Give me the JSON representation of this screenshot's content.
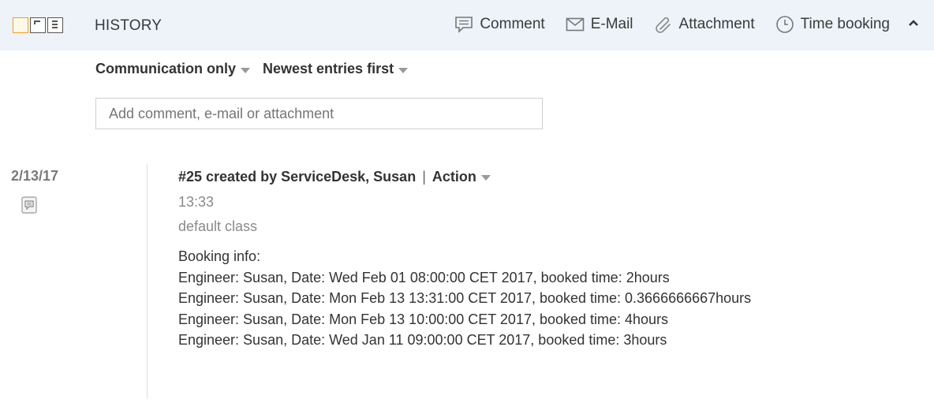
{
  "header": {
    "title": "HISTORY",
    "actions": {
      "comment": "Comment",
      "email": "E-Mail",
      "attachment": "Attachment",
      "time_booking": "Time booking"
    }
  },
  "filters": {
    "type": "Communication only",
    "order": "Newest entries first"
  },
  "add_box": {
    "placeholder": "Add comment, e-mail or attachment"
  },
  "entry": {
    "date": "2/13/17",
    "title": "#25 created by ServiceDesk, Susan",
    "separator": "|",
    "action": "Action",
    "time": "13:33",
    "class": "default class",
    "body_heading": "Booking info:",
    "lines": [
      "Engineer: Susan, Date: Wed Feb 01 08:00:00 CET 2017, booked time: 2hours",
      "Engineer: Susan, Date: Mon Feb 13 13:31:00 CET 2017, booked time: 0.3666666667hours",
      "Engineer: Susan, Date: Mon Feb 13 10:00:00 CET 2017, booked time: 4hours",
      "Engineer: Susan, Date: Wed Jan 11 09:00:00 CET 2017, booked time: 3hours"
    ]
  },
  "colors": {
    "header_bg": "#eef3f9",
    "active_toggle": "#f0a020",
    "muted_text": "#8a8a8a"
  }
}
